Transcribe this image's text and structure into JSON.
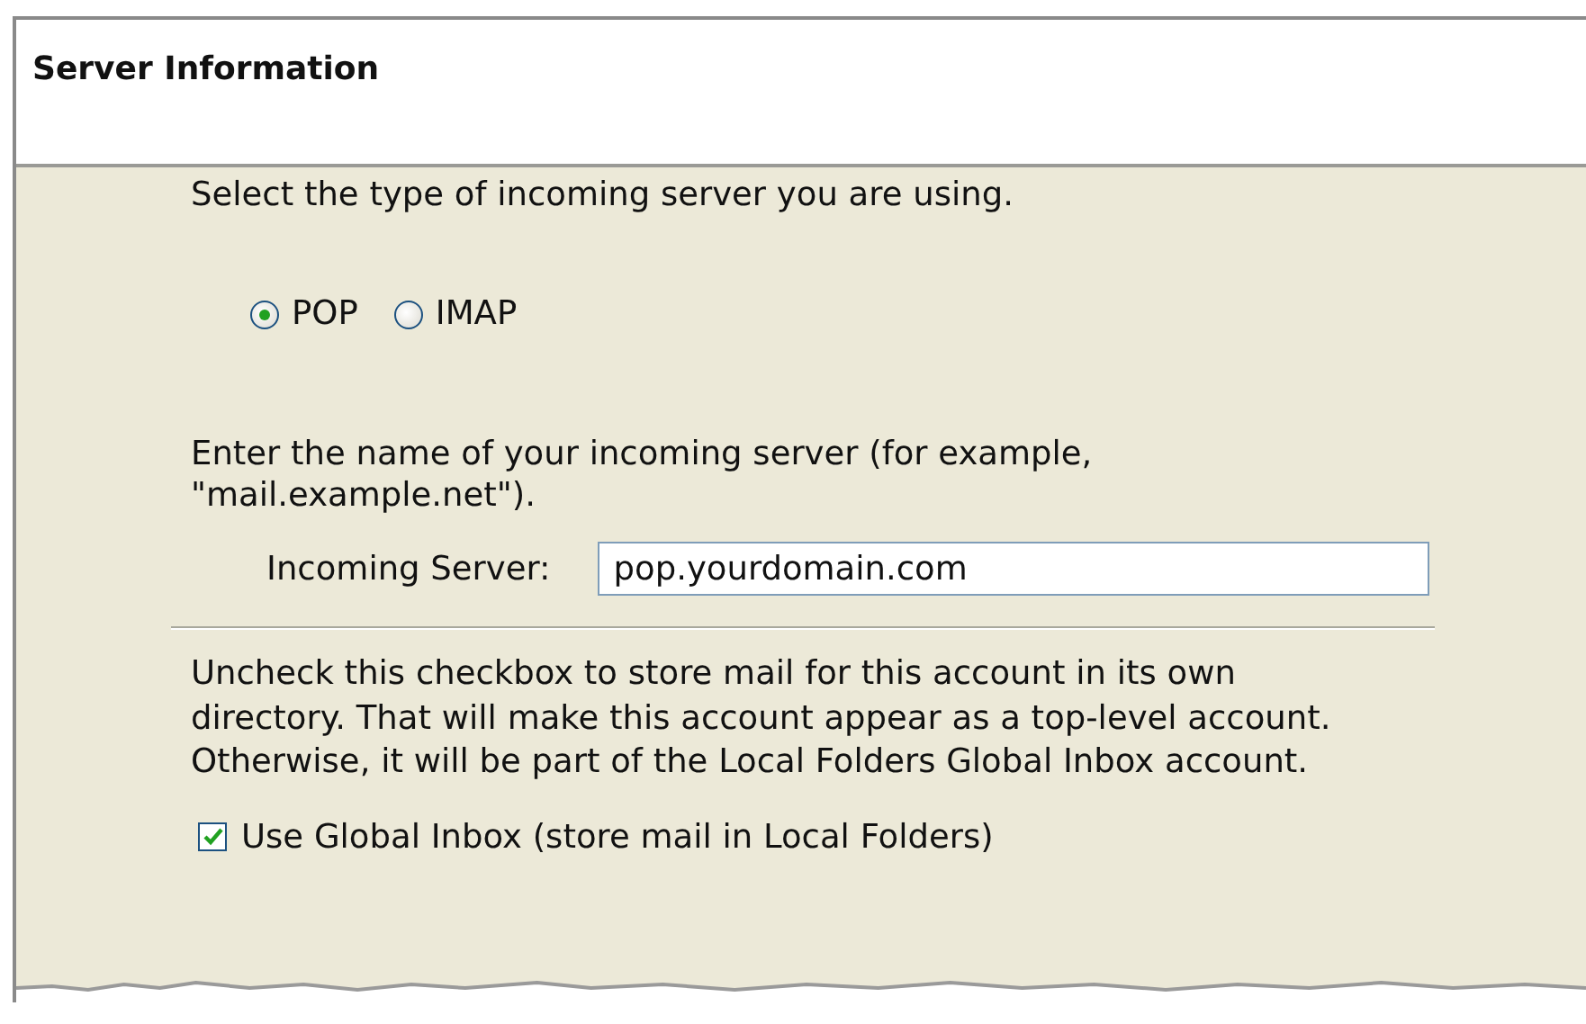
{
  "header": {
    "title": "Server Information"
  },
  "server_type": {
    "prompt": "Select the type of incoming server you are using.",
    "options": [
      {
        "label": "POP",
        "selected": true
      },
      {
        "label": "IMAP",
        "selected": false
      }
    ]
  },
  "server_name": {
    "prompt": "Enter the name of your incoming server (for example, \"mail.example.net\").",
    "label": "Incoming Server:",
    "value": "pop.yourdomain.com"
  },
  "inbox": {
    "explanation": "Uncheck this checkbox to store mail for this account in its own directory. That will make this account appear as a top-level account. Otherwise, it will be part of the Local Folders Global Inbox account.",
    "checkbox": {
      "label": "Use Global Inbox (store mail in Local Folders)",
      "checked": true
    }
  }
}
